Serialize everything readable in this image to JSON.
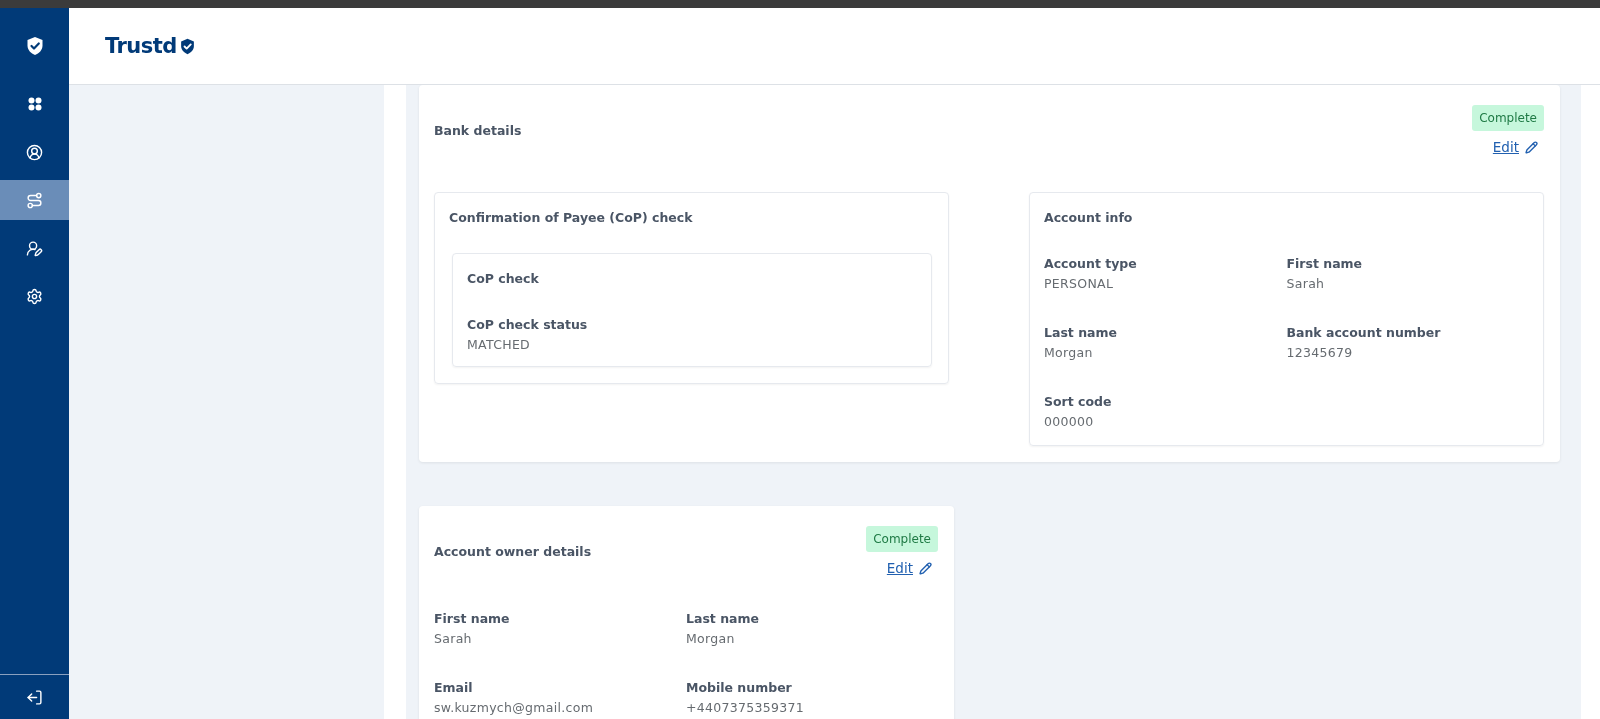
{
  "sidebar": {
    "items": [
      {
        "kind": "grid",
        "selected": false
      },
      {
        "kind": "profile",
        "selected": false
      },
      {
        "kind": "route",
        "selected": true
      },
      {
        "kind": "user-assign",
        "selected": false
      },
      {
        "kind": "settings",
        "selected": false
      }
    ]
  },
  "header": {
    "logo": "Trustd"
  },
  "sections": [
    {
      "title": "Bank details",
      "status": "Complete",
      "edit": "Edit",
      "panels": [
        {
          "title": "Confirmation of Payee (CoP) check",
          "subpanels": [
            {
              "title": "CoP check",
              "fields": [
                {
                  "label": "CoP check status",
                  "value": "MATCHED"
                }
              ]
            }
          ]
        },
        {
          "title": "Account info",
          "fields": [
            {
              "label": "Account type",
              "value": "PERSONAL"
            },
            {
              "label": "First name",
              "value": "Sarah"
            },
            {
              "label": "Last name",
              "value": "Morgan"
            },
            {
              "label": "Bank account number",
              "value": "12345679"
            },
            {
              "label": "Sort code",
              "value": "000000"
            }
          ]
        }
      ]
    },
    {
      "title": "Account owner details",
      "status": "Complete",
      "edit": "Edit",
      "fields": [
        {
          "label": "First name",
          "value": "Sarah"
        },
        {
          "label": "Last name",
          "value": "Morgan"
        },
        {
          "label": "Email",
          "value": "sw.kuzmych@gmail.com"
        },
        {
          "label": "Mobile number",
          "value": "+4407375359371"
        }
      ]
    }
  ]
}
